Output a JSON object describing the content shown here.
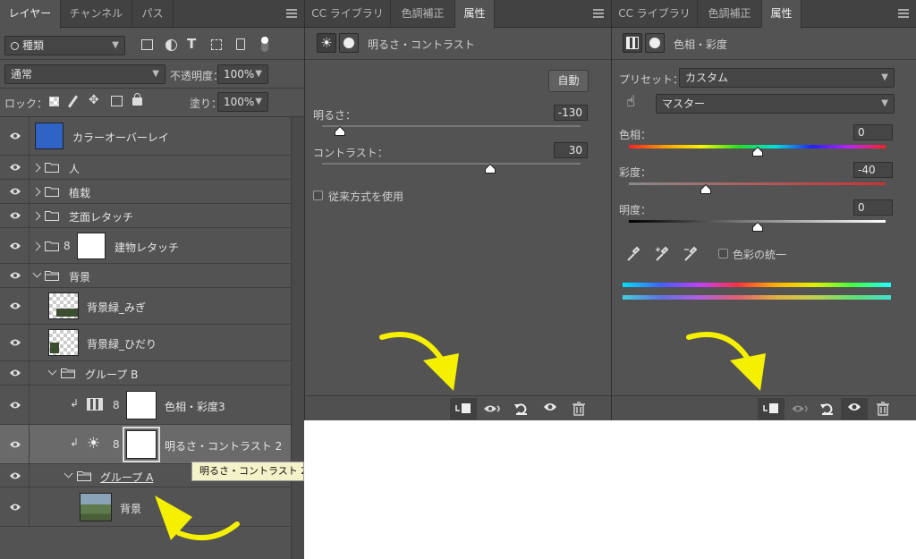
{
  "layers_panel": {
    "tabs": [
      "レイヤー",
      "チャンネル",
      "パス"
    ],
    "filter_kind": "種類",
    "blend_mode": "通常",
    "opacity_label": "不透明度：",
    "opacity_value": "100%",
    "lock_label": "ロック：",
    "fill_label": "塗り：",
    "fill_value": "100%",
    "layers": [
      {
        "name": "カラーオーバーレイ"
      },
      {
        "name": "人"
      },
      {
        "name": "植栽"
      },
      {
        "name": "芝面レタッチ"
      },
      {
        "name": "建物レタッチ"
      },
      {
        "name": "背景"
      },
      {
        "name": "背景緑_みぎ"
      },
      {
        "name": "背景緑_ひだり"
      },
      {
        "name": "グループ B"
      },
      {
        "name": "色相・彩度3"
      },
      {
        "name": "明るさ・コントラスト 2"
      },
      {
        "name": "グループ A"
      },
      {
        "name": "背景"
      }
    ],
    "tooltip": "明るさ・コントラスト 2"
  },
  "brightness_panel": {
    "tabs": [
      "CC ライブラリ",
      "色調補正",
      "属性"
    ],
    "title": "明るさ・コントラスト",
    "auto_button": "自動",
    "brightness_label": "明るさ：",
    "brightness_value": "-130",
    "brightness_level": 0.07,
    "contrast_label": "コントラスト：",
    "contrast_value": "30",
    "contrast_level": 0.65,
    "legacy_label": "従来方式を使用"
  },
  "huesat_panel": {
    "tabs": [
      "CC ライブラリ",
      "色調補正",
      "属性"
    ],
    "title": "色相・彩度",
    "preset_label": "プリセット：",
    "preset_value": "カスタム",
    "channel_value": "マスター",
    "hue_label": "色相：",
    "hue_value": "0",
    "hue_level": 0.5,
    "saturation_label": "彩度：",
    "saturation_value": "-40",
    "saturation_level": 0.3,
    "lightness_label": "明度：",
    "lightness_value": "0",
    "lightness_level": 0.5,
    "colorize_label": "色彩の統一"
  },
  "colors": {
    "panel_bg": "#535353",
    "selected_row": "#6a6a6a",
    "overlay_thumb": "#2f63c6",
    "arrow": "#f5f000",
    "tooltip_bg": "#f4f2c8"
  }
}
